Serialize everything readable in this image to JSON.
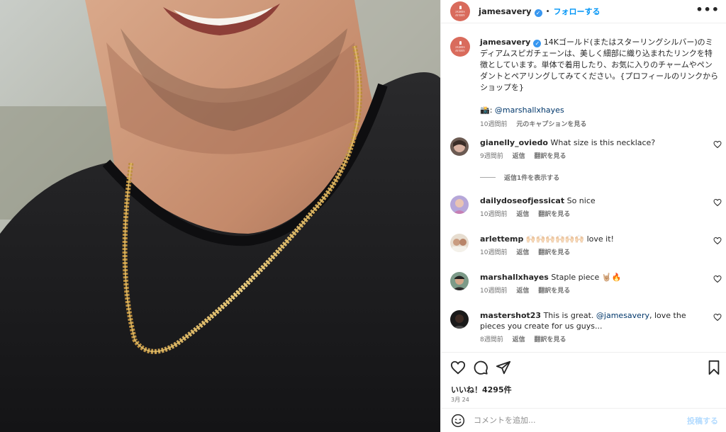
{
  "post": {
    "username": "jamesavery",
    "brand_avatar_text": "JAMES AVERY",
    "follow_label": "フォローする",
    "more_label": "•••",
    "accent": "#0095f6",
    "brand_color": "#d96b5c"
  },
  "caption": {
    "username": "jamesavery",
    "text": "14Kゴールド(またはスターリングシルバー)のミディアムスピガチェーンは、美しく細部に織り込まれたリンクを特徴としています。単体で着用したり、お気に入りのチャームやペンダントとペアリングしてみてください。{プロフィールのリンクからショップを}",
    "credit_prefix": "📸: ",
    "credit_mention": "@marshallxhayes",
    "time": "10週間前",
    "see_original": "元のキャプションを見る"
  },
  "comments": [
    {
      "username": "gianelly_oviedo",
      "text": "What size is this necklace?",
      "time": "9週間前",
      "reply": "返信",
      "translate": "翻訳を見る",
      "avatar_color": "#c9a7b5"
    },
    {
      "username": "dailydoseofjessicat",
      "text": "So nice",
      "time": "10週間前",
      "reply": "返信",
      "translate": "翻訳を見る",
      "avatar_color": "#a58fcf"
    },
    {
      "username": "arlettemp",
      "text_emoji": "🙌🏻🙌🏻🙌🏻🙌🏻🙌🏻🙌🏻",
      "text": "love it!",
      "time": "10週間前",
      "reply": "返信",
      "translate": "翻訳を見る",
      "avatar_color": "#d4b89a"
    },
    {
      "username": "marshallxhayes",
      "text": "Staple piece 🤘🏼🔥",
      "time": "10週間前",
      "reply": "返信",
      "translate": "翻訳を見る",
      "avatar_color": "#5d7a6a"
    },
    {
      "username": "mastershot23",
      "text_before": "This is great.",
      "mention": "@jamesavery",
      "text_after": ", love the pieces you create for us guys...",
      "time": "8週間前",
      "reply": "返信",
      "translate": "翻訳を見る",
      "avatar_color": "#2a2a2a"
    }
  ],
  "view_replies": "返信1件を表示する",
  "likes": "いいね！4295件",
  "date": "3月 24",
  "comment_box": {
    "placeholder": "コメントを追加...",
    "post_label": "投稿する"
  }
}
